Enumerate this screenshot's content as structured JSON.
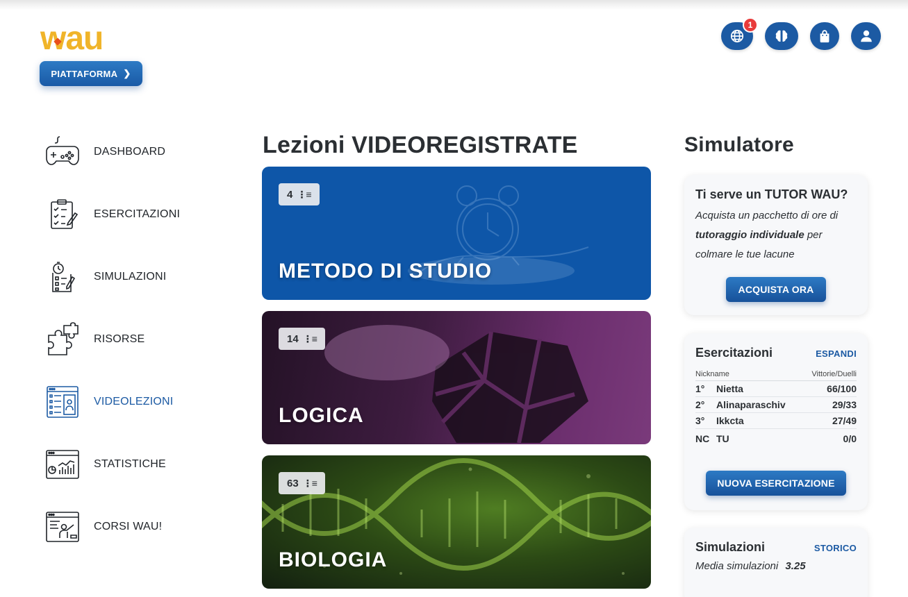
{
  "brand": {
    "logo_text": "wau",
    "platform_button": "PIATTAFORMA"
  },
  "header": {
    "icons": [
      {
        "name": "globe-icon",
        "badge": "1"
      },
      {
        "name": "brain-icon"
      },
      {
        "name": "shopping-bag-icon"
      },
      {
        "name": "user-icon"
      }
    ]
  },
  "sidebar": {
    "items": [
      {
        "label": "DASHBOARD",
        "icon": "gamepad-icon"
      },
      {
        "label": "ESERCITAZIONI",
        "icon": "checklist-clipboard-icon"
      },
      {
        "label": "SIMULAZIONI",
        "icon": "stopwatch-checklist-icon"
      },
      {
        "label": "RISORSE",
        "icon": "puzzle-icon"
      },
      {
        "label": "VIDEOLEZIONI",
        "icon": "video-lesson-icon",
        "active": true
      },
      {
        "label": "STATISTICHE",
        "icon": "statistics-chart-icon"
      },
      {
        "label": "CORSI WAU!",
        "icon": "teacher-board-icon"
      }
    ]
  },
  "main": {
    "title": "Lezioni VIDEOREGISTRATE",
    "cards": [
      {
        "count": "4",
        "title": "METODO DI STUDIO"
      },
      {
        "count": "14",
        "title": "LOGICA"
      },
      {
        "count": "63",
        "title": "BIOLOGIA"
      }
    ]
  },
  "right": {
    "title": "Simulatore",
    "tutor": {
      "heading": "Ti serve un TUTOR WAU?",
      "text_1": "Acquista un pacchetto di ore di",
      "text_bold": "tutoraggio individuale",
      "text_2": " per",
      "text_3": "colmare le tue lacune",
      "button": "ACQUISTA ORA"
    },
    "esercitazioni": {
      "heading": "Esercitazioni",
      "link": "ESPANDI",
      "col_nickname": "Nickname",
      "col_score": "Vittorie/Duelli",
      "rows": [
        {
          "pos": "1°",
          "nick": "Nietta",
          "score": "66/100"
        },
        {
          "pos": "2°",
          "nick": "Alinaparaschiv",
          "score": "29/33"
        },
        {
          "pos": "3°",
          "nick": "Ikkcta",
          "score": "27/49"
        },
        {
          "pos": "NC",
          "nick": "TU",
          "score": "0/0"
        }
      ],
      "button": "NUOVA ESERCITAZIONE"
    },
    "simulazioni": {
      "heading": "Simulazioni",
      "link": "STORICO",
      "media_label": "Media simulazioni",
      "media_value": "3.25"
    }
  },
  "colors": {
    "brand_yellow": "#f0b429",
    "primary_blue": "#1c5aa3",
    "badge_red": "#e83b3b"
  }
}
